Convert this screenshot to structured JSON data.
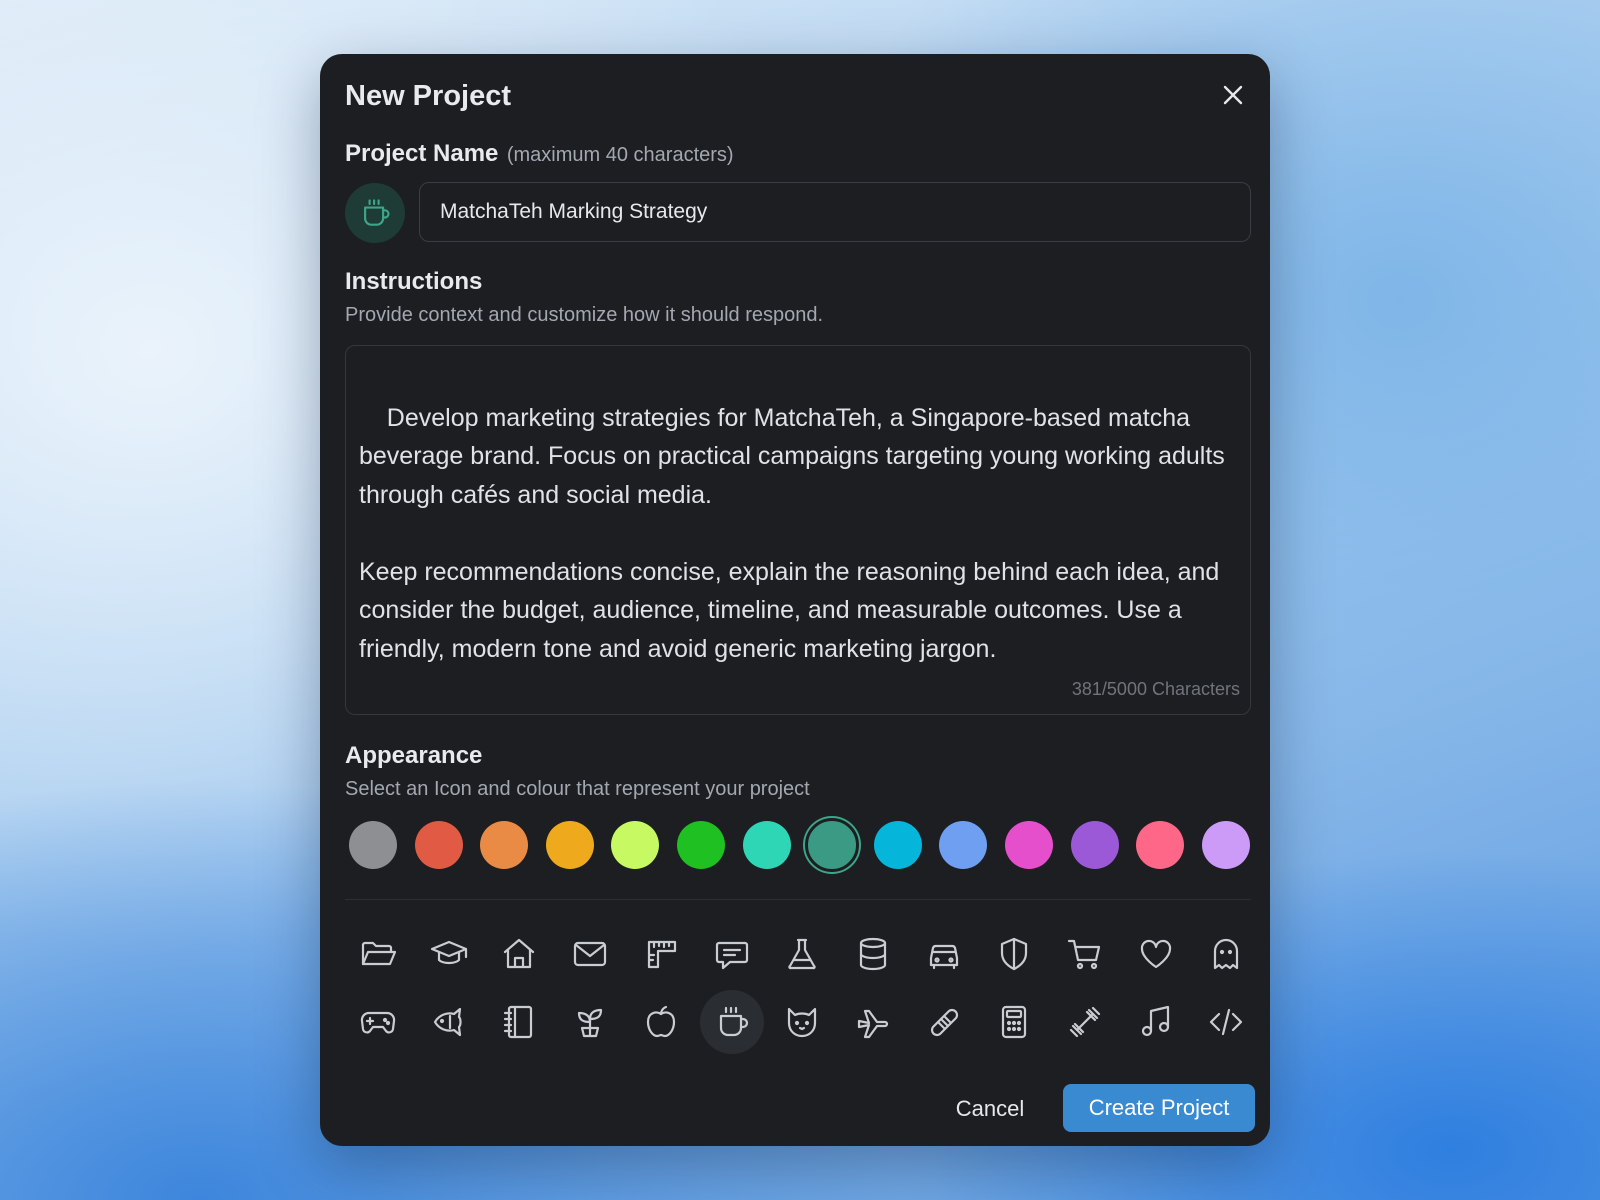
{
  "dialog": {
    "title": "New Project",
    "close_icon": "close-icon"
  },
  "project_name": {
    "label": "Project Name",
    "hint": "(maximum 40 characters)",
    "value": "MatchaTeh Marking Strategy",
    "icon": "coffee-cup-icon"
  },
  "instructions": {
    "label": "Instructions",
    "description": "Provide context and customize how it should respond.",
    "value": "Develop marketing strategies for MatchaTeh, a Singapore-based matcha beverage brand. Focus on practical campaigns targeting young working adults through cafés and social media.\n\nKeep recommendations concise, explain the reasoning behind each idea, and consider the budget, audience, timeline, and measurable outcomes. Use a friendly, modern tone and avoid generic marketing jargon.",
    "char_count": "381/5000 Characters"
  },
  "appearance": {
    "label": "Appearance",
    "description": "Select an Icon and colour that represent your project",
    "colors": [
      "#8e8f92",
      "#e05a44",
      "#ea8b45",
      "#eeaa1c",
      "#c7fa62",
      "#1fc021",
      "#2ed6b6",
      "#3a9a84",
      "#06b5da",
      "#6f9ff0",
      "#e54fcc",
      "#9b59d8",
      "#fe6787",
      "#cc9bf7"
    ],
    "selected_color": "#3a9a84",
    "icons_row1": [
      "folder-icon",
      "graduation-cap-icon",
      "home-icon",
      "mail-icon",
      "ruler-icon",
      "chat-icon",
      "flask-icon",
      "database-icon",
      "car-icon",
      "shield-icon",
      "cart-icon",
      "heart-icon",
      "ghost-icon"
    ],
    "icons_row2": [
      "gamepad-icon",
      "fish-icon",
      "notebook-icon",
      "sprout-icon",
      "apple-icon",
      "coffee-cup-icon",
      "cat-icon",
      "plane-icon",
      "bandage-icon",
      "calculator-icon",
      "dumbbell-icon",
      "music-icon",
      "code-icon"
    ],
    "selected_icon": "coffee-cup-icon"
  },
  "actions": {
    "cancel_label": "Cancel",
    "create_label": "Create Project"
  }
}
